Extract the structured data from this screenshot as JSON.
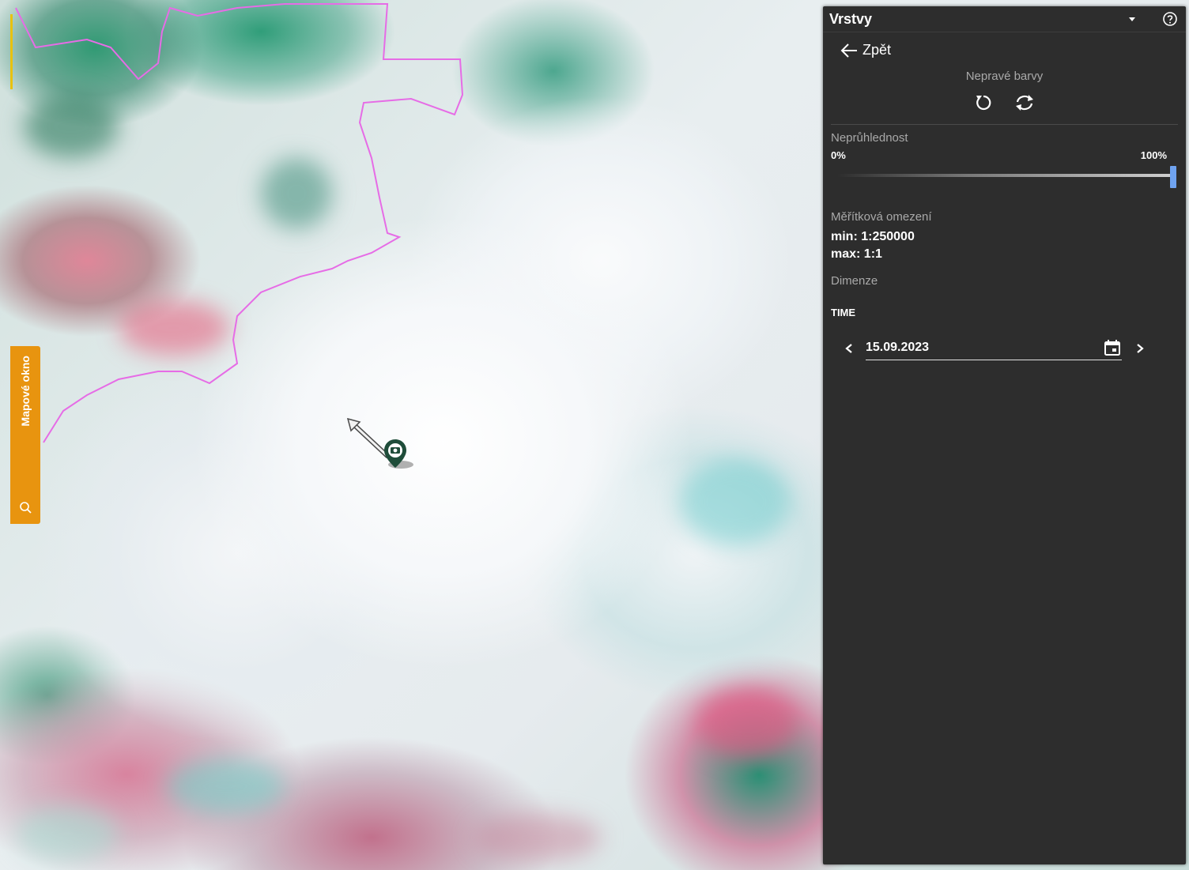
{
  "map": {
    "side_tab": {
      "label": "Mapové okno",
      "icon": "map-search-icon"
    },
    "marker": {
      "icon": "camera-pin-icon",
      "arrow_icon": "direction-arrow-icon"
    },
    "boundary_color": "#e66ce6"
  },
  "panel": {
    "title": "Vrstvy",
    "header_icons": [
      "dropdown-arrow-icon",
      "help-icon"
    ],
    "back_label": "Zpět",
    "layer_name": "Nepravé barvy",
    "layer_actions": [
      "reset-icon",
      "refresh-icon"
    ],
    "opacity": {
      "label": "Neprůhlednost",
      "min_label": "0%",
      "max_label": "100%",
      "value_percent": 100,
      "handle_color": "#6fa3f0"
    },
    "scale_limits": {
      "label": "Měřítková omezení",
      "min": "min: 1:250000",
      "max": "max: 1:1"
    },
    "dimensions": {
      "label": "Dimenze",
      "time_label": "TIME",
      "date_value": "15.09.2023",
      "calendar_icon": "calendar-icon",
      "prev_icon": "chevron-left-icon",
      "next_icon": "chevron-right-icon"
    },
    "background_color": "#2d2d2d"
  }
}
